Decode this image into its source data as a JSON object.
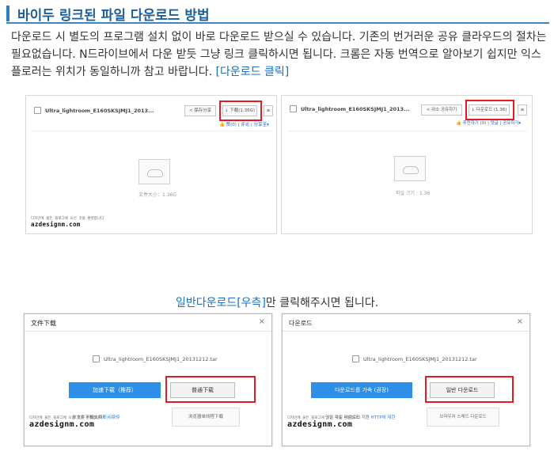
{
  "heading": {
    "title": "바이두 링크된 파일 다운로드 방법"
  },
  "description": {
    "text": "다운로드 시 별도의 프로그램 설치 없이 바로 다운로드 받으실 수 있습니다. 기존의 번거러운 공유 클라우드의 절차는 필요없습니다. N드라이브에서 다운 받듯 그냥 링크 클릭하시면 됩니다. 크롬은 자동 번역으로 알아보기 쉽지만 익스플로러는 위치가 동일하니까 참고 바랍니다. ",
    "link_label": "[다운로드 클릭]"
  },
  "watermark": {
    "small": "디자인에 물든 블로그에 오신 것을 환영합니다",
    "brand": "azdesignm.com"
  },
  "shot_left": {
    "filename": "Ultra_lightroom_E160SKSJMJ1_2013...",
    "share_label": "< 保存分享",
    "download_label": "↓ 下载(1.36G)",
    "more_label": "≡",
    "meta_label": "👍 赞(0) | 评论 | 分享至▾",
    "size_label": "文件大小：1.36G"
  },
  "shot_right": {
    "filename": "Ultra_lightroom_E160SKSJMJ1_2013...",
    "share_label": "< 위소 공유하기",
    "download_label": "↓ 다운로드 (1.36)",
    "more_label": "≡",
    "meta_label": "👍 추천하기 (0) | 댓글 | 공유하기▾",
    "size_label": "파일 크기 : 1.36"
  },
  "caption": {
    "highlight": "일반다운로드[우측]",
    "rest": "만 클릭해주시면 됩니다."
  },
  "dialog_left": {
    "title": "文件下载",
    "close": "×",
    "filename": "Ultra_lightroom_E160SKSJMJ1_20131212.tar",
    "fast_label": "加速下载（推荐）",
    "normal_label": "普通下载",
    "tip_text": "单文件下载支持",
    "tip_link": "断点续传",
    "tip2": "浏览器单线程下载"
  },
  "dialog_right": {
    "title": "다운로드",
    "close": "×",
    "filename": "Ultra_lightroom_E160SKSJMJ1_20131212.tar",
    "fast_label": "다운로드를 가속 (권장)",
    "normal_label": "일반 다운로드",
    "tip_text": "단일 파일 다운로드 지원 ",
    "tip_link": "HTTP에 대한",
    "tip2": "브라우저 스레드 다운로드"
  },
  "colors": {
    "accent": "#1d5f9b",
    "link": "#1a6fc2",
    "highlight_box": "#e8191f",
    "primary_button": "#2d8fe6"
  }
}
